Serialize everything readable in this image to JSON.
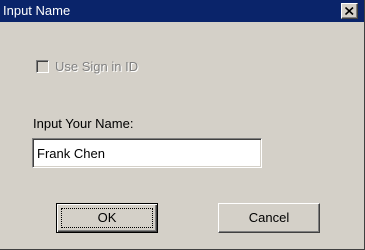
{
  "window": {
    "title": "Input Name",
    "close_icon": "close-x-icon"
  },
  "sign_in_option": {
    "label": "Use Sign in ID",
    "checked": false,
    "enabled": false
  },
  "name_field": {
    "label": "Input Your Name:",
    "value": "Frank Chen"
  },
  "buttons": {
    "ok_label": "OK",
    "cancel_label": "Cancel"
  },
  "colors": {
    "titlebar": "#0a246a",
    "dialog_face": "#d4d0c8",
    "disabled_text": "#808080"
  }
}
